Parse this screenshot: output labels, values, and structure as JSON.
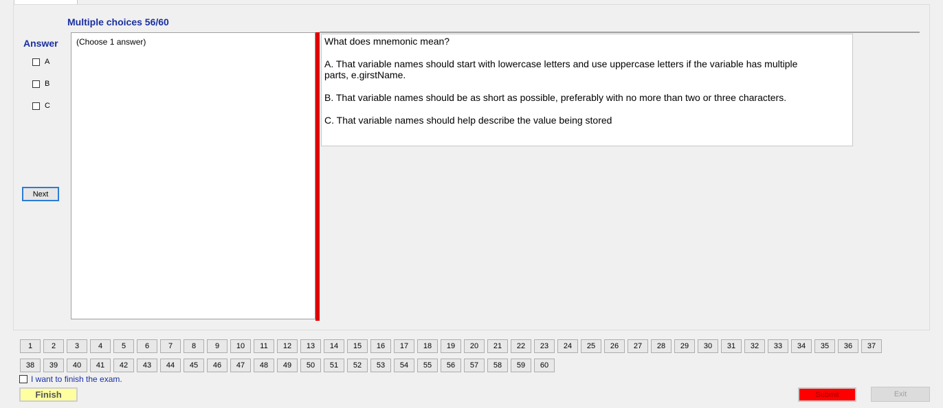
{
  "header": {
    "title": "Multiple choices 56/60"
  },
  "answer": {
    "label": "Answer",
    "options": [
      "A",
      "B",
      "C"
    ],
    "next_label": "Next"
  },
  "hint": {
    "text": "(Choose 1 answer)"
  },
  "question": {
    "title": "What does mnemonic mean?",
    "choices": [
      "A.  That variable names should start with lowercase letters and use uppercase letters if the variable has multiple parts, e.girstName.",
      "B.  That variable names should be as short as possible, preferably with no more than two or three characters.",
      "C.  That variable names should help describe the value being stored"
    ]
  },
  "navigator": {
    "row1": [
      "1",
      "2",
      "3",
      "4",
      "5",
      "6",
      "7",
      "8",
      "9",
      "10",
      "11",
      "12",
      "13",
      "14",
      "15",
      "16",
      "17",
      "18",
      "19",
      "20",
      "21",
      "22",
      "23",
      "24",
      "25",
      "26",
      "27",
      "28",
      "29",
      "30",
      "31",
      "32",
      "33",
      "34",
      "35",
      "36",
      "37"
    ],
    "row2": [
      "38",
      "39",
      "40",
      "41",
      "42",
      "43",
      "44",
      "45",
      "46",
      "47",
      "48",
      "49",
      "50",
      "51",
      "52",
      "53",
      "54",
      "55",
      "56",
      "57",
      "58",
      "59",
      "60"
    ]
  },
  "footer": {
    "finish_checkbox_label": "I want to finish the exam.",
    "finish_label": "Finish",
    "submit_label": "Submit",
    "exit_label": "Exit"
  },
  "colors": {
    "accent_text": "#1a2fa0",
    "divider_red": "#e00000",
    "finish_bg": "#ffffa0",
    "submit_bg": "#ff0000"
  }
}
